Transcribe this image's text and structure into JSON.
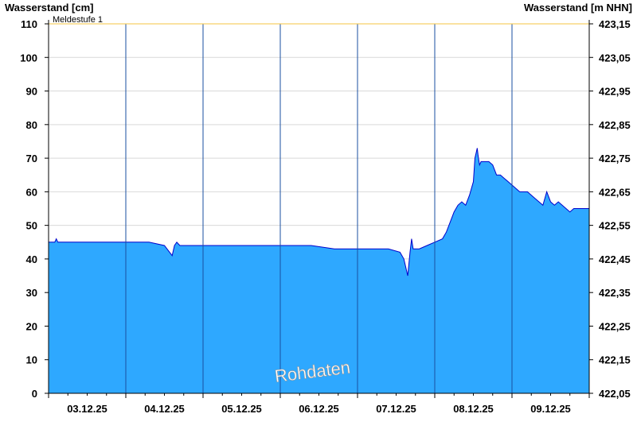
{
  "chart_data": {
    "type": "area",
    "ylabel_left": "Wasserstand [cm]",
    "ylabel_right": "Wasserstand [m NHN]",
    "ylim": [
      0,
      110
    ],
    "yticks_left": [
      0,
      10,
      20,
      30,
      40,
      50,
      60,
      70,
      80,
      90,
      100,
      110
    ],
    "yticks_right": [
      "422,05",
      "422,15",
      "422,25",
      "422,35",
      "422,45",
      "422,55",
      "422,65",
      "422,75",
      "422,85",
      "422,95",
      "423,05",
      "423,15"
    ],
    "xlim_days": [
      0,
      7
    ],
    "x_categories": [
      "03.12.25",
      "04.12.25",
      "05.12.25",
      "06.12.25",
      "07.12.25",
      "08.12.25",
      "09.12.25"
    ],
    "threshold": {
      "label": "Meldestufe 1",
      "value": 110,
      "color": "#f5c542"
    },
    "watermark": "Rohdaten",
    "grid": true,
    "colors": {
      "fill": "#2ea8ff",
      "line": "#0000cc",
      "day_divider": "#1a4fa0",
      "grid": "#d9d9d9"
    },
    "series": [
      {
        "x": [
          0,
          0.08,
          0.1,
          0.12,
          0.15,
          0.3,
          0.5,
          0.7,
          0.9,
          1.1,
          1.3,
          1.5,
          1.6,
          1.63,
          1.66,
          1.7,
          1.9,
          2.2,
          2.5,
          2.8,
          3.1,
          3.4,
          3.7,
          3.8,
          4.0,
          4.2,
          4.4,
          4.55,
          4.6,
          4.65,
          4.68,
          4.7,
          4.72,
          4.75,
          4.8,
          4.9,
          5.0,
          5.1,
          5.15,
          5.2,
          5.25,
          5.3,
          5.35,
          5.4,
          5.45,
          5.5,
          5.52,
          5.55,
          5.56,
          5.58,
          5.6,
          5.65,
          5.7,
          5.75,
          5.8,
          5.85,
          5.9,
          5.95,
          6.0,
          6.05,
          6.1,
          6.2,
          6.3,
          6.4,
          6.45,
          6.5,
          6.55,
          6.6,
          6.65,
          6.7,
          6.75,
          6.8,
          6.9,
          7.0
        ],
        "y": [
          45,
          45,
          46,
          45,
          45,
          45,
          45,
          45,
          45,
          45,
          45,
          44,
          41,
          44,
          45,
          44,
          44,
          44,
          44,
          44,
          44,
          44,
          43,
          43,
          43,
          43,
          43,
          42,
          40,
          35,
          42,
          46,
          43,
          43,
          43,
          44,
          45,
          46,
          48,
          51,
          54,
          56,
          57,
          56,
          59,
          63,
          70,
          73,
          71,
          68,
          69,
          69,
          69,
          68,
          65,
          65,
          64,
          63,
          62,
          61,
          60,
          60,
          58,
          56,
          60,
          57,
          56,
          57,
          56,
          55,
          54,
          55,
          55,
          55
        ]
      }
    ]
  }
}
